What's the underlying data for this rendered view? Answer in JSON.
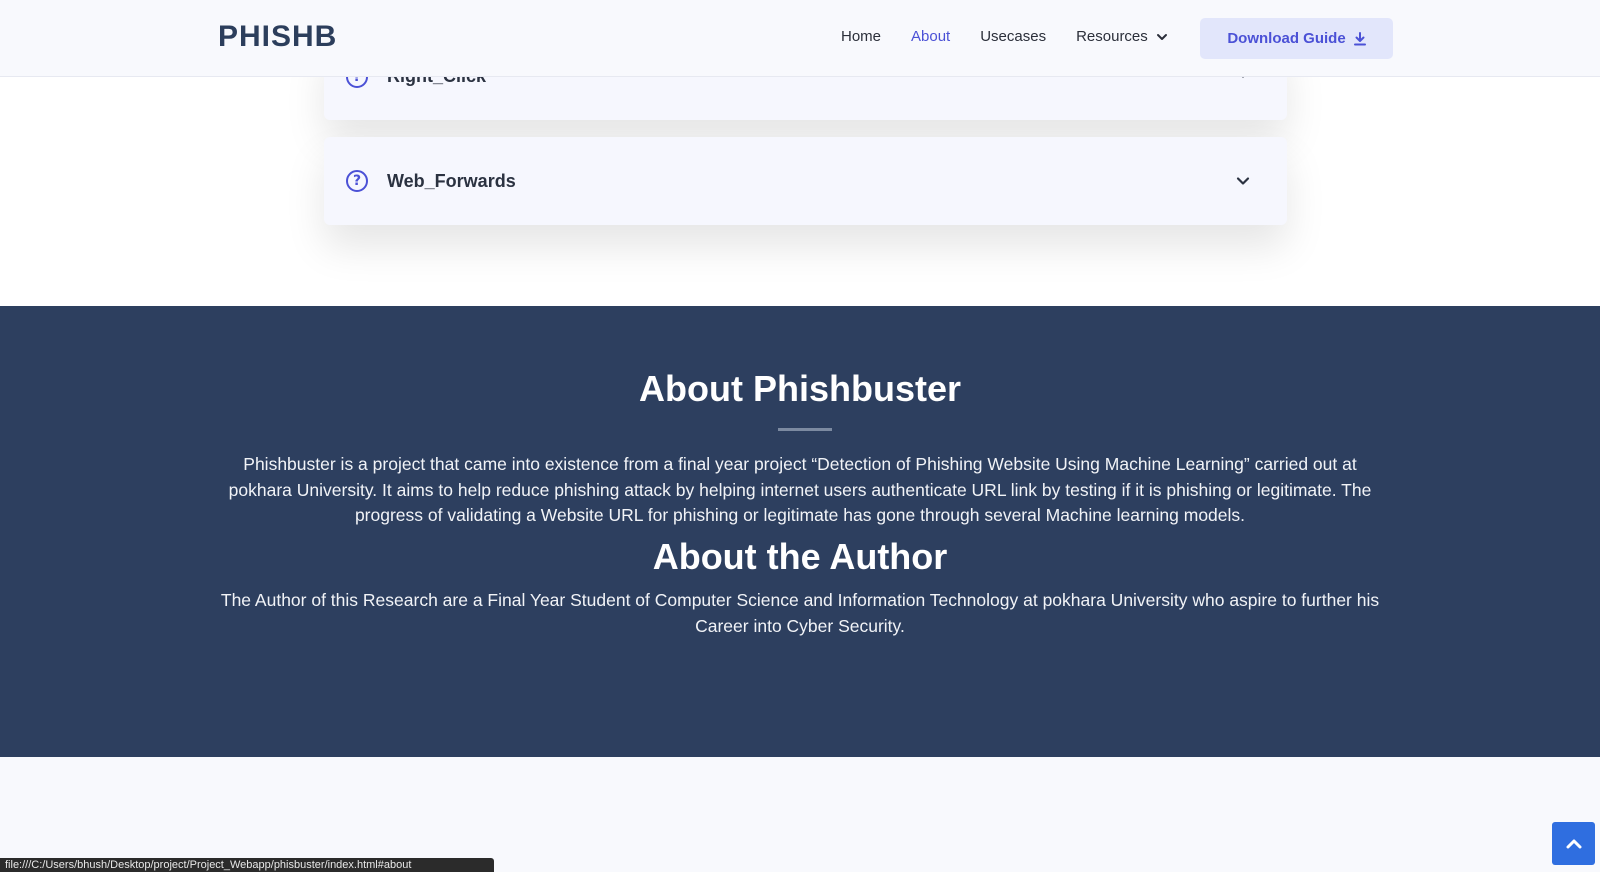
{
  "header": {
    "logo": "PHISHB",
    "nav": [
      {
        "label": "Home"
      },
      {
        "label": "About"
      },
      {
        "label": "Usecases"
      },
      {
        "label": "Resources"
      }
    ],
    "download_label": "Download Guide"
  },
  "faq": {
    "items": [
      {
        "title": "Right_Click"
      },
      {
        "title": "Web_Forwards"
      }
    ]
  },
  "about": {
    "title": "About Phishbuster",
    "text": "Phishbuster is a project that came into existence from a final year project “Detection of Phishing Website Using Machine Learning” carried out at pokhara University. It aims to help reduce phishing attack by helping internet users authenticate URL link by testing if it is phishing or legitimate. The progress of validating a Website URL for phishing or legitimate has gone through several Machine learning models.",
    "author_title": "About the Author",
    "author_text": "The Author of this Research are a Final Year Student of Computer Science and Information Technology at pokhara University who aspire to further his Career into Cyber Security."
  },
  "status_url": "file:///C:/Users/bhush/Desktop/project/Project_Webapp/phisbuster/index.html#about",
  "colors": {
    "accent": "#4b51d6",
    "section_bg": "#2d3f5f",
    "back_to_top": "#2f6ee0"
  }
}
